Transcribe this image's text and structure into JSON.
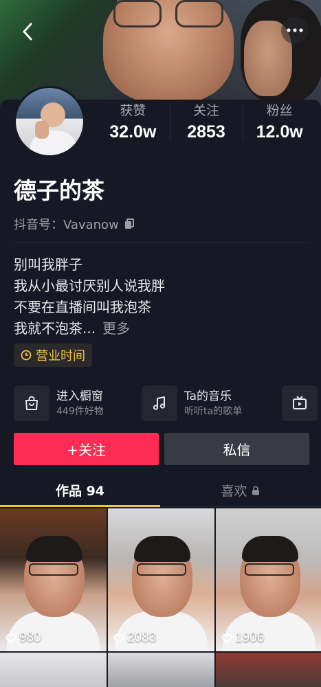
{
  "header": {
    "back_icon": "chevron-left-icon",
    "more_icon": "more-dots-icon"
  },
  "profile": {
    "name": "德子的茶",
    "douyin_id": "抖音号：Vavanow",
    "copy_icon": "copy-icon",
    "stats": [
      {
        "label": "获赞",
        "value": "32.0w"
      },
      {
        "label": "关注",
        "value": "2853"
      },
      {
        "label": "粉丝",
        "value": "12.0w"
      }
    ],
    "bio": {
      "lines": [
        "别叫我胖子",
        "我从小最讨厌别人说我胖",
        "不要在直播间叫我泡茶",
        "我就不泡茶..."
      ],
      "more_label": "更多"
    },
    "business_tag": "营业时间"
  },
  "services": [
    {
      "title": "进入橱窗",
      "subtitle": "449件好物",
      "icon": "shopping-bag-icon"
    },
    {
      "title": "Ta的音乐",
      "subtitle": "听听ta的歌单",
      "icon": "music-note-icon"
    },
    {
      "title": "",
      "subtitle": "",
      "icon": "tv-icon"
    }
  ],
  "actions": {
    "follow_label": "+关注",
    "message_label": "私信"
  },
  "tabs": [
    {
      "label": "作品 94",
      "active": true
    },
    {
      "label": "喜欢",
      "active": false,
      "icon": "lock-icon"
    }
  ],
  "videos": [
    {
      "likes": "980"
    },
    {
      "likes": "2083"
    },
    {
      "likes": "1906"
    }
  ],
  "colors": {
    "background": "#161823",
    "accent": "#fe2c55",
    "tab_indicator": "#f2c23b",
    "business_tag": "#f2c23b"
  }
}
